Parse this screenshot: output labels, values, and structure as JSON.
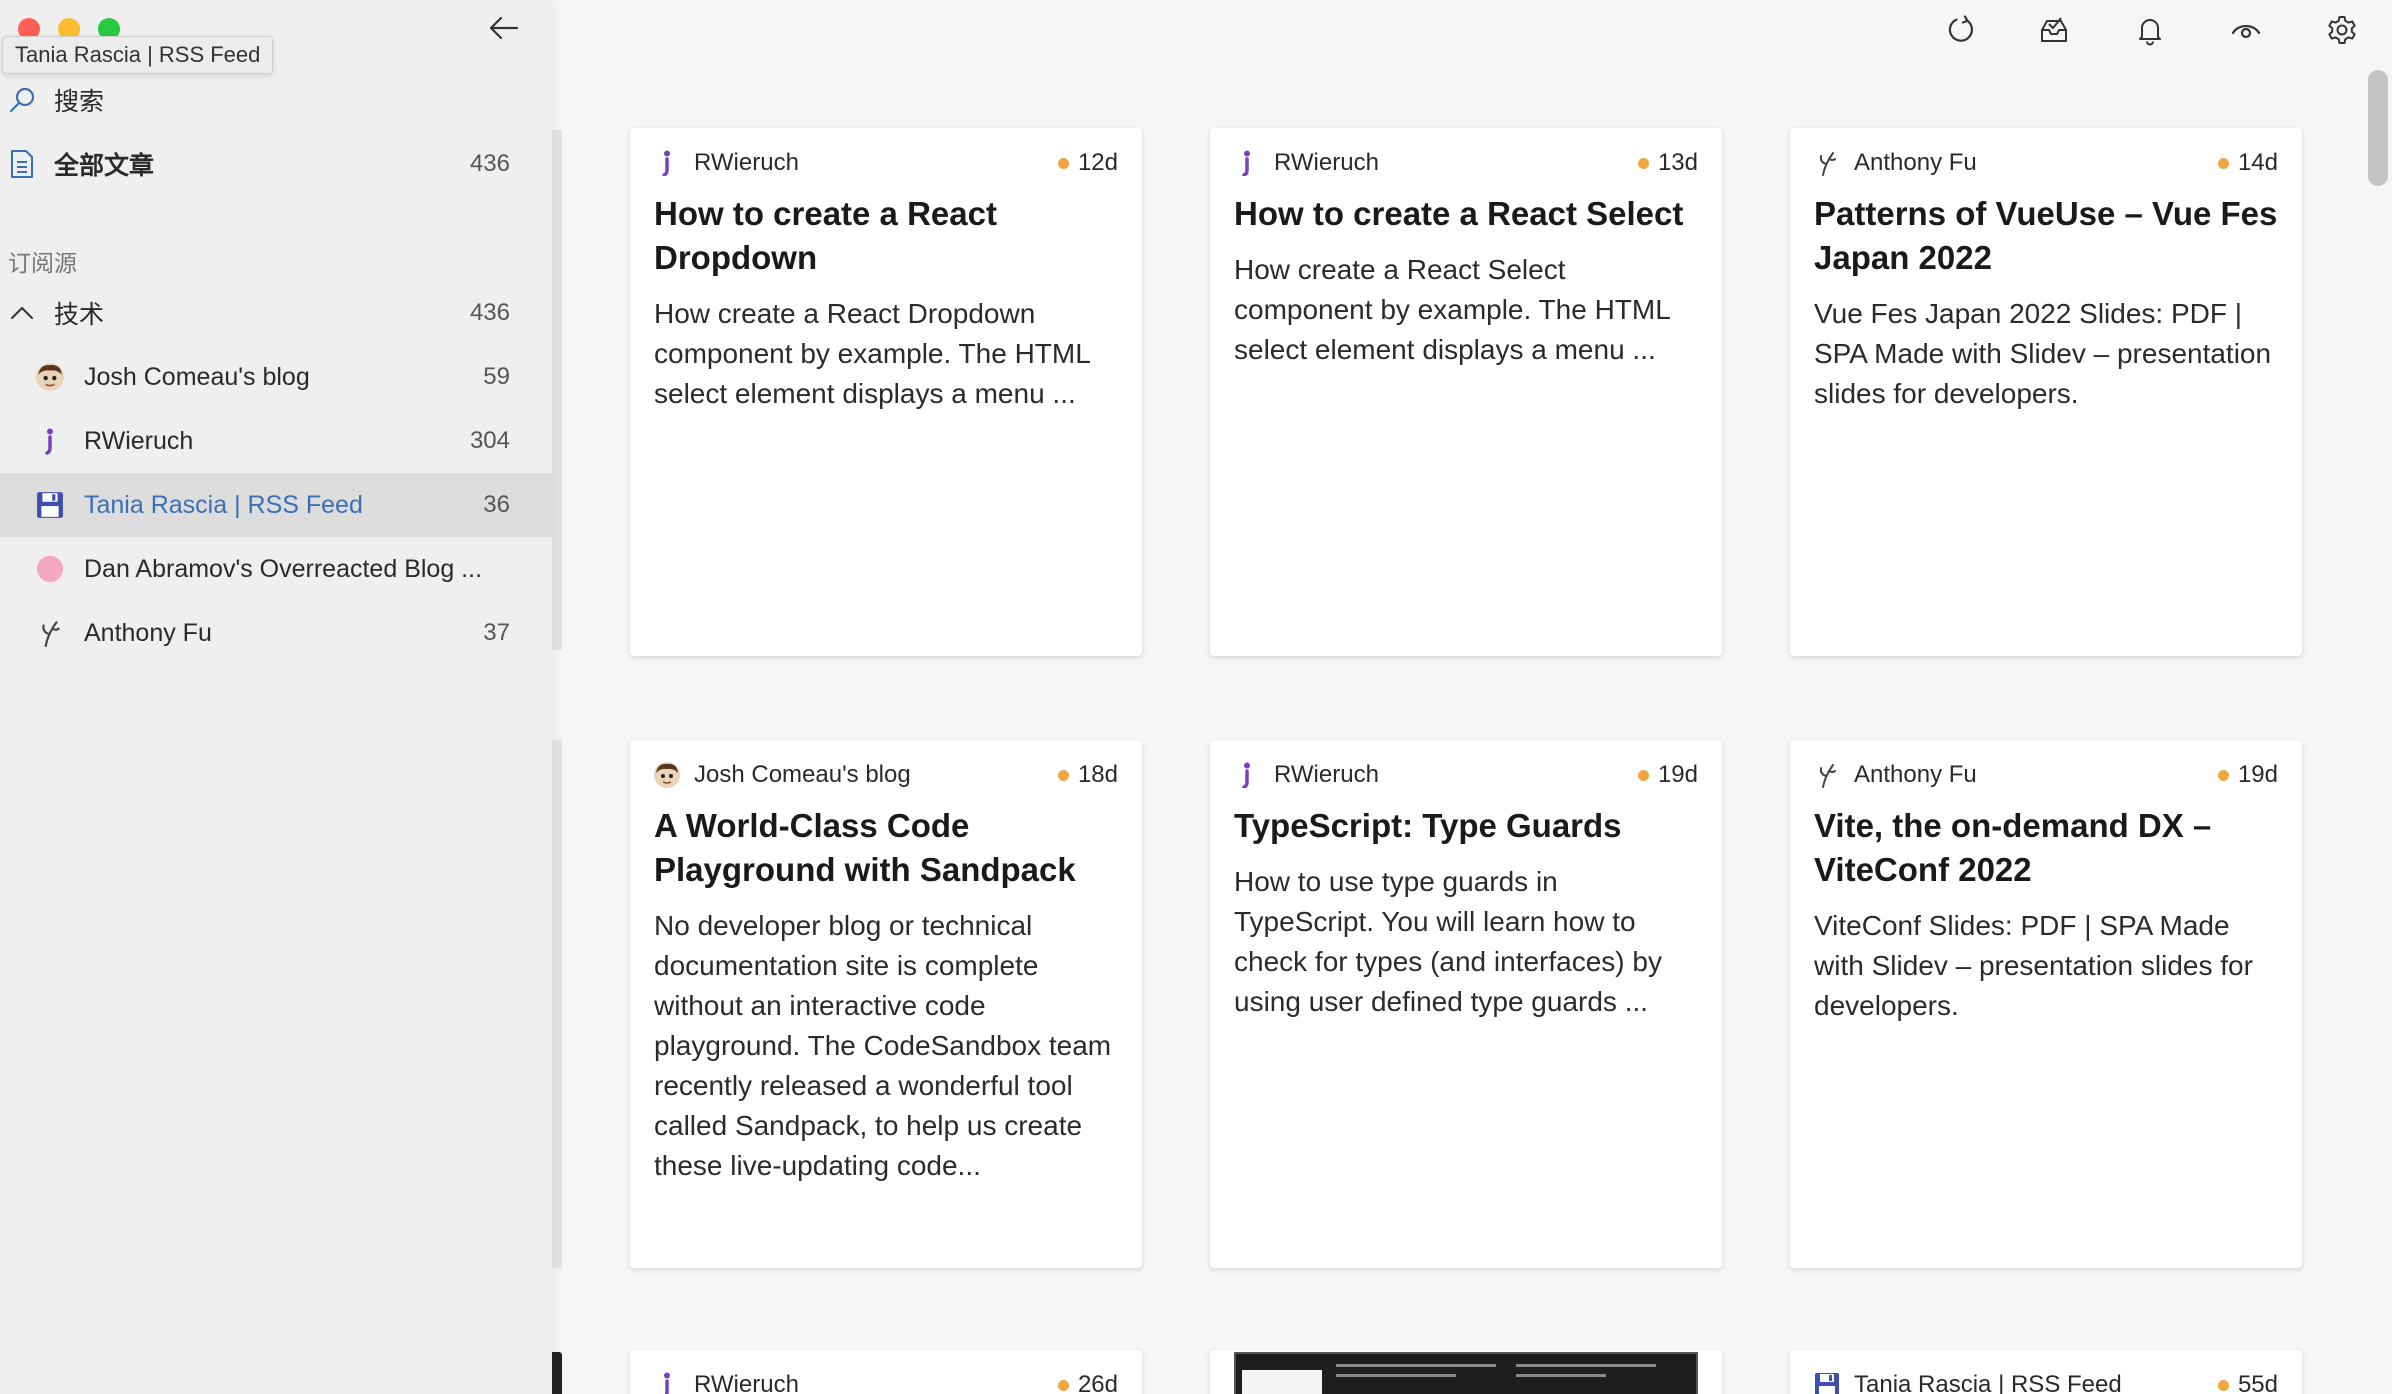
{
  "window": {
    "tooltip": "Tania Rascia | RSS Feed",
    "traffic_colors": {
      "close": "#fe5f57",
      "minimize": "#febc2e",
      "zoom": "#28c840"
    }
  },
  "toolbar": {
    "icons": [
      "refresh-icon",
      "mark-all-read-icon",
      "notification-icon",
      "view-icon",
      "settings-icon"
    ]
  },
  "sidebar": {
    "search_label": "搜索",
    "all_articles": {
      "label": "全部文章",
      "count": "436"
    },
    "section_label": "订阅源",
    "group": {
      "label": "技术",
      "count": "436"
    },
    "feeds": [
      {
        "label": "Josh Comeau's blog",
        "count": "59",
        "icon": "josh-avatar-icon"
      },
      {
        "label": "RWieruch",
        "count": "304",
        "icon": "rwieruch-icon"
      },
      {
        "label": "Tania Rascia | RSS Feed",
        "count": "36",
        "icon": "floppy-disk-icon",
        "selected": true
      },
      {
        "label": "Dan Abramov's Overreacted Blog ...",
        "count": "",
        "icon": "pink-circle-icon"
      },
      {
        "label": "Anthony Fu",
        "count": "37",
        "icon": "anthony-fu-icon"
      }
    ],
    "selected_color": "#3a6fb6"
  },
  "cards": [
    {
      "source": "RWieruch",
      "age": "12d",
      "title": "How to create a React Dropdown",
      "snippet": "How create a React Dropdown component by example. The HTML select element displays a menu ..."
    },
    {
      "source": "RWieruch",
      "age": "13d",
      "title": "How to create a React Select",
      "snippet": "How create a React Select component by example. The HTML select element displays a menu ..."
    },
    {
      "source": "Anthony Fu",
      "age": "14d",
      "title": "Patterns of VueUse – Vue Fes Japan 2022",
      "snippet": "Vue Fes Japan 2022 Slides: PDF | SPA Made with Slidev – presentation slides for developers."
    },
    {
      "source": "Josh Comeau's blog",
      "age": "18d",
      "title": "A World-Class Code Playground with Sandpack",
      "snippet": "No developer blog or technical documentation site is complete without an interactive code playground. The CodeSandbox team recently released a wonderful tool called Sandpack, to help us create these live-updating code..."
    },
    {
      "source": "RWieruch",
      "age": "19d",
      "title": "TypeScript: Type Guards",
      "snippet": "How to use type guards in TypeScript. You will learn how to check for types (and interfaces) by using user defined type guards ..."
    },
    {
      "source": "Anthony Fu",
      "age": "19d",
      "title": "Vite, the on-demand DX – ViteConf 2022",
      "snippet": "ViteConf Slides: PDF | SPA Made with Slidev – presentation slides for developers."
    },
    {
      "source": "RWieruch",
      "age": "26d",
      "title": "",
      "snippet": ""
    },
    {
      "source": "",
      "age": "",
      "title": "",
      "snippet": ""
    },
    {
      "source": "Tania Rascia | RSS Feed",
      "age": "55d",
      "title": "",
      "snippet": ""
    }
  ],
  "age_dot_color": "#f0a640"
}
